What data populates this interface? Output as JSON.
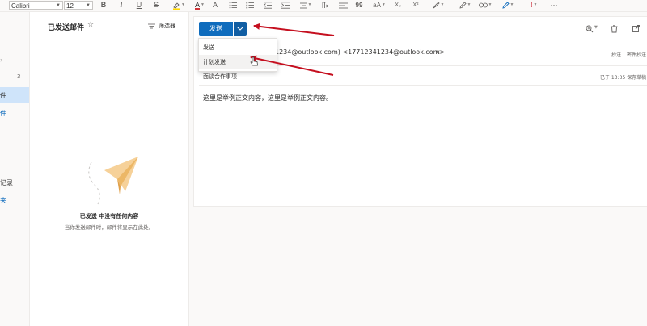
{
  "toolbar": {
    "font_name": "Calibri",
    "font_size": "12",
    "bold": "B",
    "italic": "I",
    "underline": "U",
    "strike": "S",
    "font_color_glyph": "A",
    "format_painter_glyph": "A",
    "quote_glyph": "99",
    "case_glyph": "aA",
    "subscript": "X₂",
    "superscript": "X²",
    "more": "···"
  },
  "leftnav": {
    "items": [
      {
        "label": "",
        "count": "3"
      },
      {
        "label": "件",
        "selected": true
      },
      {
        "label": "件",
        "accent": true
      },
      {
        "label": "记录"
      },
      {
        "label": "夹",
        "accent": true
      }
    ]
  },
  "list": {
    "title": "已发送邮件",
    "filter_label": "筛选器",
    "empty_title": "已发送 中没有任何内容",
    "empty_subtitle": "当你发送邮件时，邮件将显示在此处。"
  },
  "compose": {
    "send_label": "发送",
    "menu": [
      "发送",
      "计划发送"
    ],
    "to_text": "1234@outlook.com) <17712341234@outlook.com>",
    "remove_glyph": "×",
    "cc_label": "抄送",
    "bcc_label": "密件抄送",
    "subject": "面谈合作事项",
    "saved_status": "已于 13:35 保存草稿",
    "body": "这里是举例正文内容，这里是举例正文内容。"
  },
  "colors": {
    "accent": "#0f6cbd",
    "selected_bg": "#cfe4fa",
    "arrow": "#c50f1f",
    "plane": "#f6d199"
  }
}
